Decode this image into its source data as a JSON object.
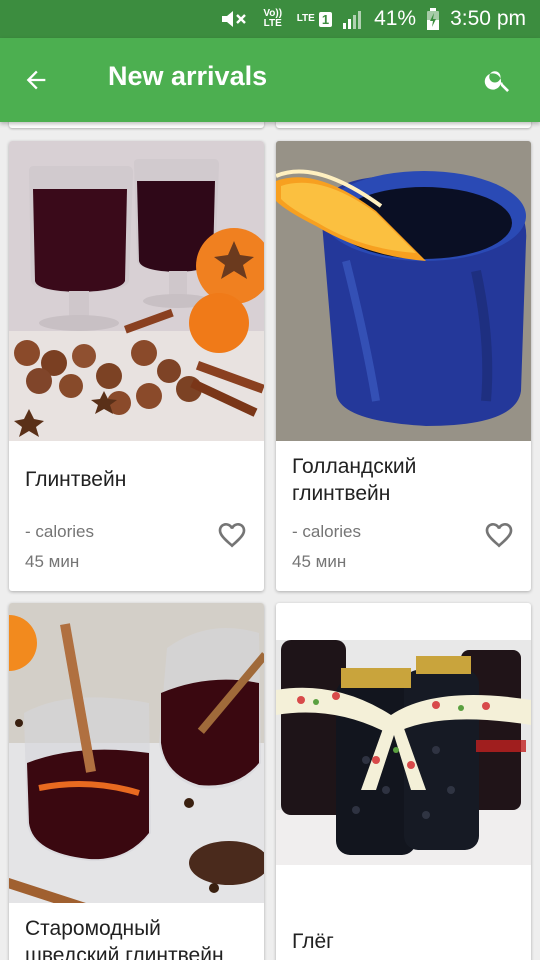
{
  "status_bar": {
    "volte_label": "Vo)) LTE",
    "lte_label": "LTE",
    "sim_slot": "1",
    "battery": "41%",
    "time": "3:50 pm"
  },
  "app_bar": {
    "title": "New arrivals",
    "back_icon": "arrow-back-icon",
    "search_icon": "search-icon"
  },
  "recipes": [
    {
      "title": "Глинтвейн",
      "calories": "- calories",
      "time": "45 мин",
      "favorite_icon": "heart-outline-icon"
    },
    {
      "title": "Голландский глинтвейн",
      "calories": "- calories",
      "time": "45 мин",
      "favorite_icon": "heart-outline-icon"
    },
    {
      "title": "Старомодный шведский глинтвейн"
    },
    {
      "title": "Глёг"
    }
  ],
  "colors": {
    "status_bar": "#3c8d3f",
    "app_bar": "#4caf50",
    "background": "#eeeeee"
  }
}
